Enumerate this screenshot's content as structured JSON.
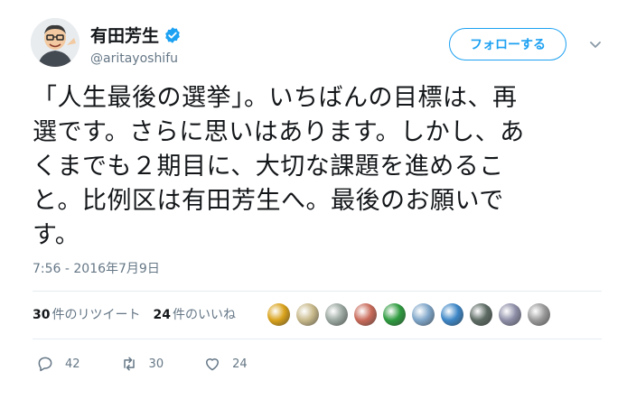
{
  "user": {
    "display_name": "有田芳生",
    "handle": "@aritayoshifu",
    "verified": true,
    "follow_label": "フォローする"
  },
  "tweet": {
    "lines": [
      "「人生最後の選挙」。いちばんの目標は、再",
      "選です。さらに思いはあります。しかし、あ",
      "くまでも２期目に、大切な課題を進めるこ",
      "と。比例区は有田芳生へ。最後のお願いで",
      "す。"
    ],
    "timestamp": "7:56 - 2016年7月9日"
  },
  "stats": {
    "retweets_count": "30",
    "retweets_label": "件のリツイート",
    "likes_count": "24",
    "likes_label": "件のいいね"
  },
  "likers": [
    {
      "icon": "liker-avatar-1",
      "color": "#d9a21b"
    },
    {
      "icon": "liker-avatar-2",
      "color": "#c8b98a"
    },
    {
      "icon": "liker-avatar-3",
      "color": "#9aa7a0"
    },
    {
      "icon": "liker-avatar-4",
      "color": "#c96b5a"
    },
    {
      "icon": "liker-avatar-5",
      "color": "#2e9b3f"
    },
    {
      "icon": "liker-avatar-6",
      "color": "#7fa6c9"
    },
    {
      "icon": "liker-avatar-7",
      "color": "#3d86c6"
    },
    {
      "icon": "liker-avatar-8",
      "color": "#5d6b64"
    },
    {
      "icon": "liker-avatar-9",
      "color": "#8e8fa8"
    },
    {
      "icon": "liker-avatar-10",
      "color": "#9a9a9a"
    }
  ],
  "actions": {
    "reply_count": "42",
    "retweet_count": "30",
    "like_count": "24"
  },
  "colors": {
    "accent": "#1da1f2",
    "text": "#14171a",
    "muted": "#657786"
  }
}
